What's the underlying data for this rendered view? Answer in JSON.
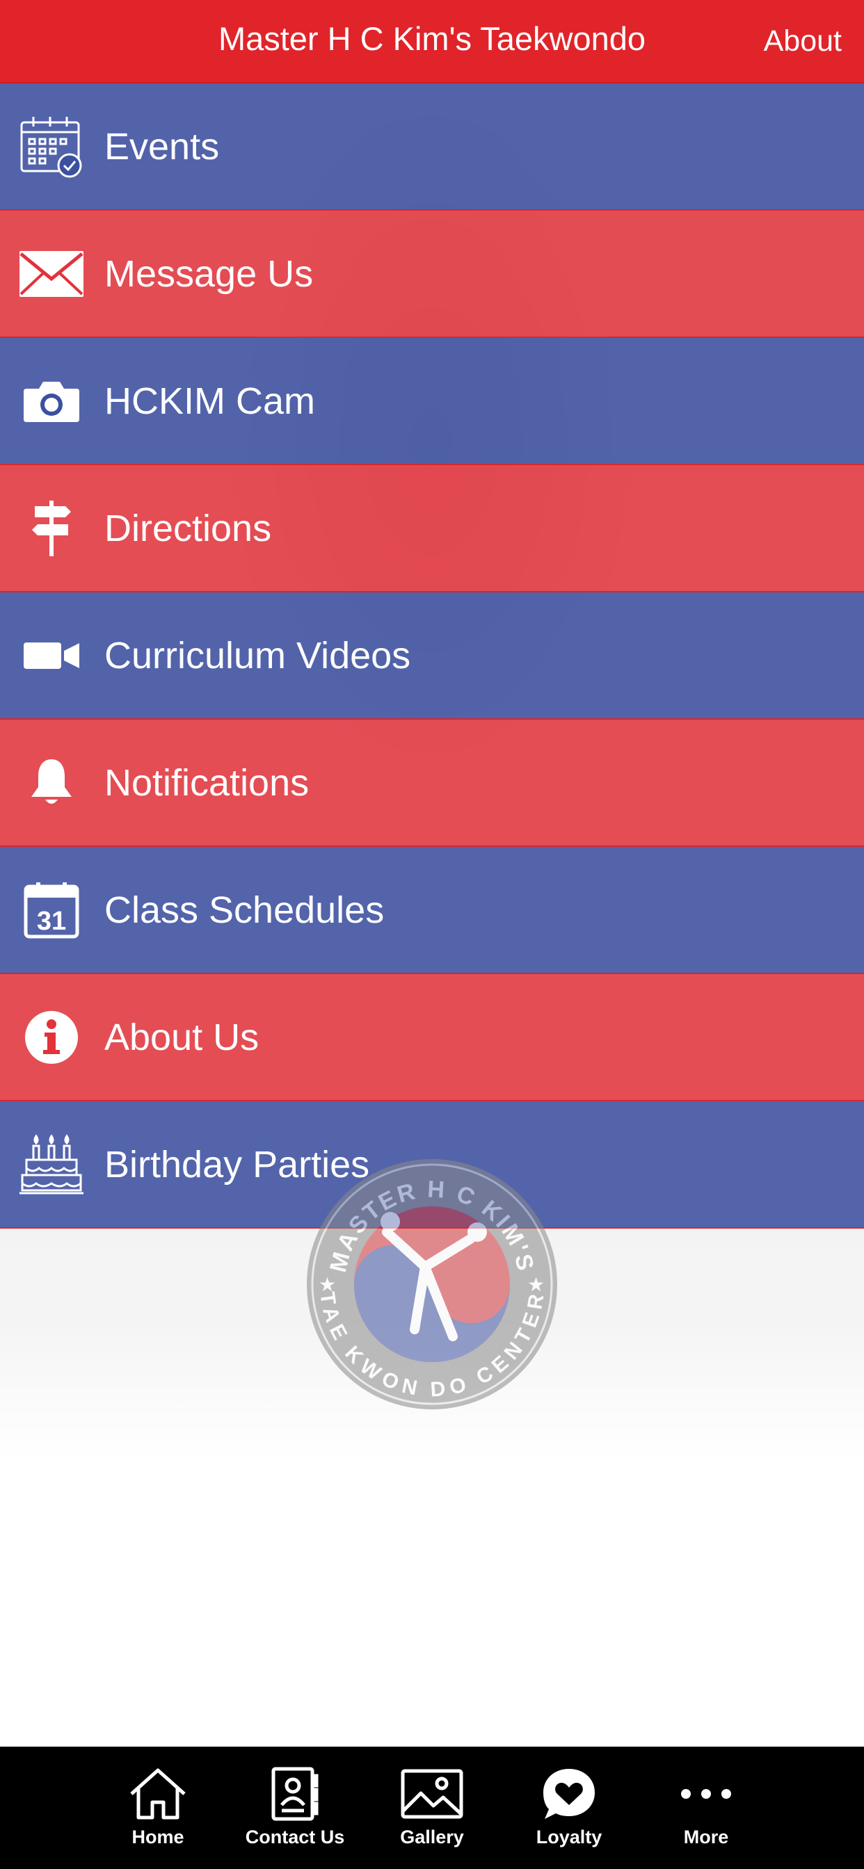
{
  "header": {
    "title": "Master H C Kim's Taekwondo",
    "about_label": "About",
    "color": "#e0242a"
  },
  "menu": {
    "items": [
      {
        "label": "Events",
        "icon": "calendar-check-icon",
        "color": "blue"
      },
      {
        "label": "Message Us",
        "icon": "envelope-icon",
        "color": "red"
      },
      {
        "label": "HCKIM Cam",
        "icon": "camera-icon",
        "color": "blue"
      },
      {
        "label": "Directions",
        "icon": "signpost-icon",
        "color": "red"
      },
      {
        "label": "Curriculum Videos",
        "icon": "video-camera-icon",
        "color": "blue"
      },
      {
        "label": "Notifications",
        "icon": "bell-icon",
        "color": "red"
      },
      {
        "label": "Class Schedules",
        "icon": "calendar-31-icon",
        "color": "blue"
      },
      {
        "label": "About Us",
        "icon": "info-icon",
        "color": "red"
      },
      {
        "label": "Birthday Parties",
        "icon": "birthday-cake-icon",
        "color": "blue"
      }
    ],
    "calendar_day": "31",
    "colors": {
      "blue": "#3c50a0",
      "red": "#e2323a"
    }
  },
  "logo": {
    "top_text": "MASTER H C KIM'S",
    "bottom_text": "TAE KWON DO CENTER"
  },
  "tabbar": {
    "tabs": [
      {
        "label": "Home",
        "icon": "home-icon"
      },
      {
        "label": "Contact Us",
        "icon": "contact-card-icon"
      },
      {
        "label": "Gallery",
        "icon": "gallery-icon"
      },
      {
        "label": "Loyalty",
        "icon": "heart-bubble-icon"
      },
      {
        "label": "More",
        "icon": "more-dots-icon"
      }
    ]
  }
}
